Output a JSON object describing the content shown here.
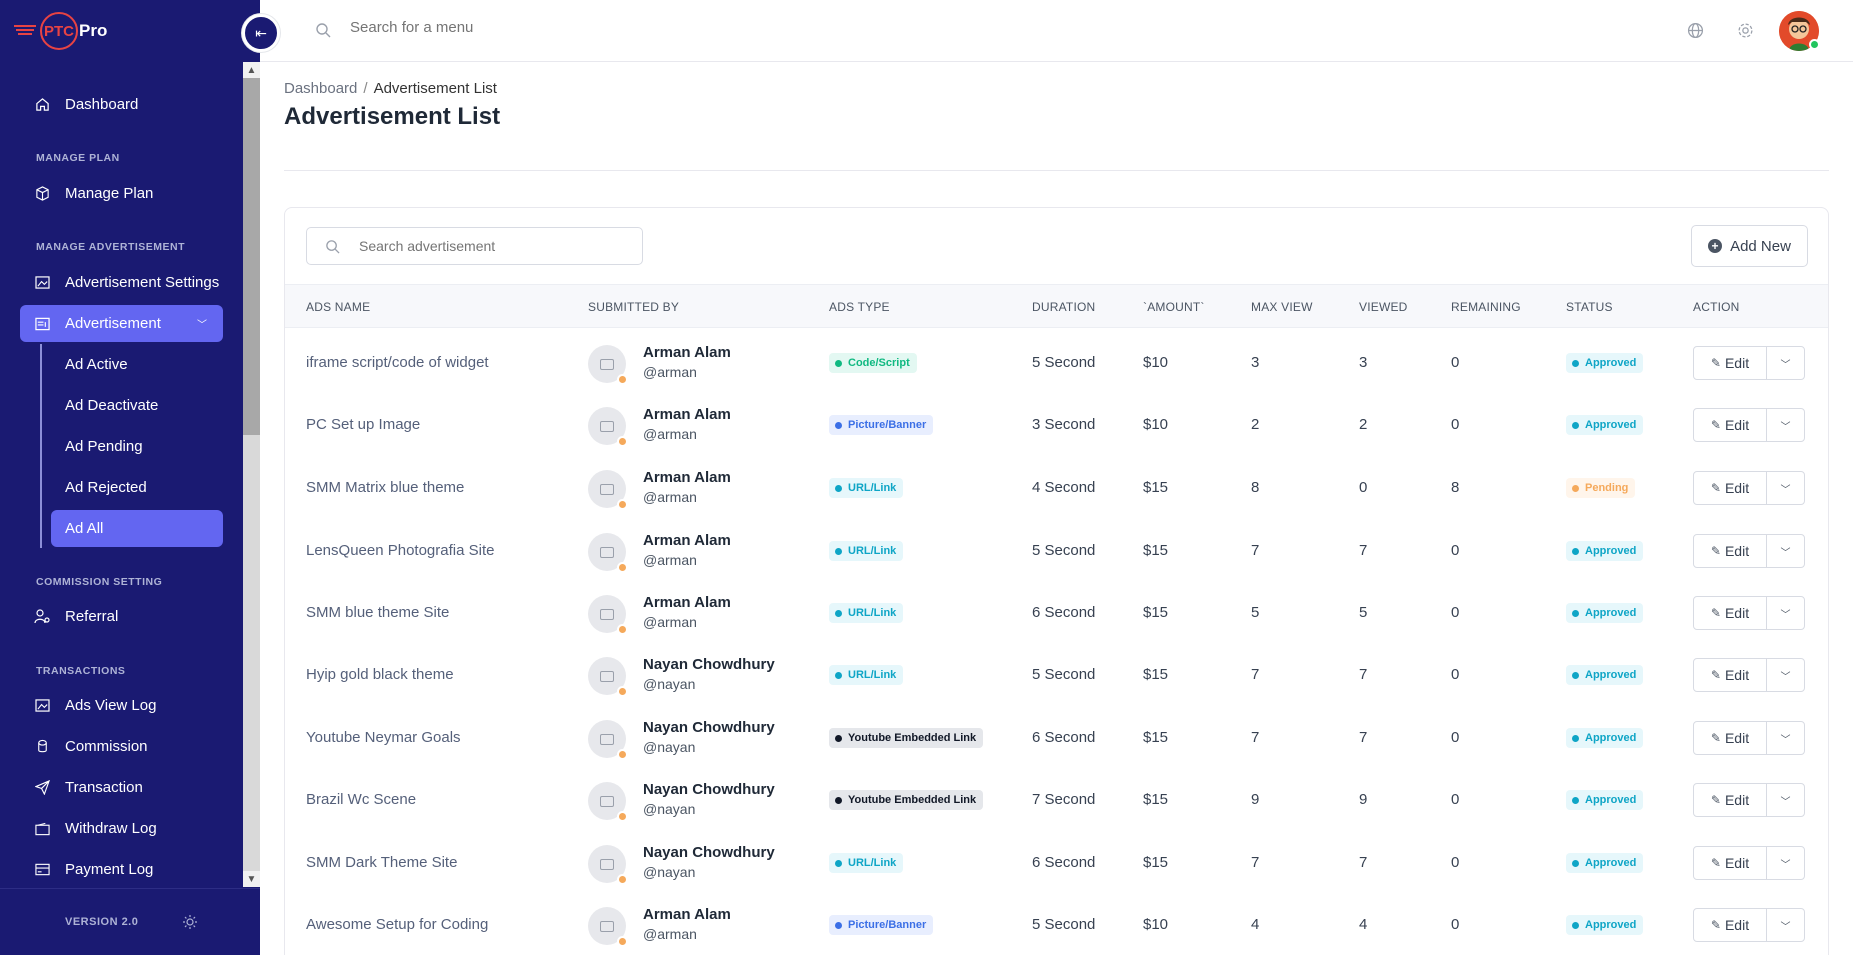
{
  "brand": {
    "logo_text": "PTC",
    "name": "Pro"
  },
  "topbar": {
    "search_placeholder": "Search for a menu"
  },
  "sidebar": {
    "dashboard": "Dashboard",
    "sections": {
      "manage_plan": "MANAGE PLAN",
      "manage_advertisement": "MANAGE ADVERTISEMENT",
      "commission_setting": "COMMISSION SETTING",
      "transactions": "TRANSACTIONS"
    },
    "manage_plan": "Manage Plan",
    "advertisement_settings": "Advertisement Settings",
    "advertisement": "Advertisement",
    "sub_items": [
      "Ad Active",
      "Ad Deactivate",
      "Ad Pending",
      "Ad Rejected",
      "Ad All"
    ],
    "referral": "Referral",
    "ads_view_log": "Ads View Log",
    "commission": "Commission",
    "transaction": "Transaction",
    "withdraw_log": "Withdraw Log",
    "payment_log": "Payment Log",
    "version": "VERSION 2.0"
  },
  "breadcrumb": {
    "home": "Dashboard",
    "current": "Advertisement List"
  },
  "page_title": "Advertisement List",
  "card": {
    "search_placeholder": "Search advertisement",
    "add_new": "Add New"
  },
  "table": {
    "headers": [
      "ADS NAME",
      "SUBMITTED BY",
      "ADS TYPE",
      "DURATION",
      "`AMOUNT`",
      "MAX VIEW",
      "VIEWED",
      "REMAINING",
      "STATUS",
      "ACTION"
    ],
    "edit_label": "Edit",
    "rows": [
      {
        "name": "iframe script/code of widget",
        "user": "Arman Alam",
        "handle": "@arman",
        "type": "Code/Script",
        "duration": "5 Second",
        "amount": "$10",
        "max_view": "3",
        "viewed": "3",
        "remaining": "0",
        "status": "Approved"
      },
      {
        "name": "PC Set up Image",
        "user": "Arman Alam",
        "handle": "@arman",
        "type": "Picture/Banner",
        "duration": "3 Second",
        "amount": "$10",
        "max_view": "2",
        "viewed": "2",
        "remaining": "0",
        "status": "Approved"
      },
      {
        "name": "SMM Matrix blue theme",
        "user": "Arman Alam",
        "handle": "@arman",
        "type": "URL/Link",
        "duration": "4 Second",
        "amount": "$15",
        "max_view": "8",
        "viewed": "0",
        "remaining": "8",
        "status": "Pending"
      },
      {
        "name": "LensQueen Photografia Site",
        "user": "Arman Alam",
        "handle": "@arman",
        "type": "URL/Link",
        "duration": "5 Second",
        "amount": "$15",
        "max_view": "7",
        "viewed": "7",
        "remaining": "0",
        "status": "Approved"
      },
      {
        "name": "SMM blue theme Site",
        "user": "Arman Alam",
        "handle": "@arman",
        "type": "URL/Link",
        "duration": "6 Second",
        "amount": "$15",
        "max_view": "5",
        "viewed": "5",
        "remaining": "0",
        "status": "Approved"
      },
      {
        "name": "Hyip gold black theme",
        "user": "Nayan Chowdhury",
        "handle": "@nayan",
        "type": "URL/Link",
        "duration": "5 Second",
        "amount": "$15",
        "max_view": "7",
        "viewed": "7",
        "remaining": "0",
        "status": "Approved"
      },
      {
        "name": "Youtube Neymar Goals",
        "user": "Nayan Chowdhury",
        "handle": "@nayan",
        "type": "Youtube Embedded Link",
        "duration": "6 Second",
        "amount": "$15",
        "max_view": "7",
        "viewed": "7",
        "remaining": "0",
        "status": "Approved"
      },
      {
        "name": "Brazil Wc Scene",
        "user": "Nayan Chowdhury",
        "handle": "@nayan",
        "type": "Youtube Embedded Link",
        "duration": "7 Second",
        "amount": "$15",
        "max_view": "9",
        "viewed": "9",
        "remaining": "0",
        "status": "Approved"
      },
      {
        "name": "SMM Dark Theme Site",
        "user": "Nayan Chowdhury",
        "handle": "@nayan",
        "type": "URL/Link",
        "duration": "6 Second",
        "amount": "$15",
        "max_view": "7",
        "viewed": "7",
        "remaining": "0",
        "status": "Approved"
      },
      {
        "name": "Awesome Setup for Coding",
        "user": "Arman Alam",
        "handle": "@arman",
        "type": "Picture/Banner",
        "duration": "5 Second",
        "amount": "$10",
        "max_view": "4",
        "viewed": "4",
        "remaining": "0",
        "status": "Approved"
      }
    ]
  },
  "colors": {
    "sidebar_bg": "#1a1a72",
    "accent": "#6366f1",
    "approved": "#0ea5c6",
    "pending": "#f5a95b"
  }
}
